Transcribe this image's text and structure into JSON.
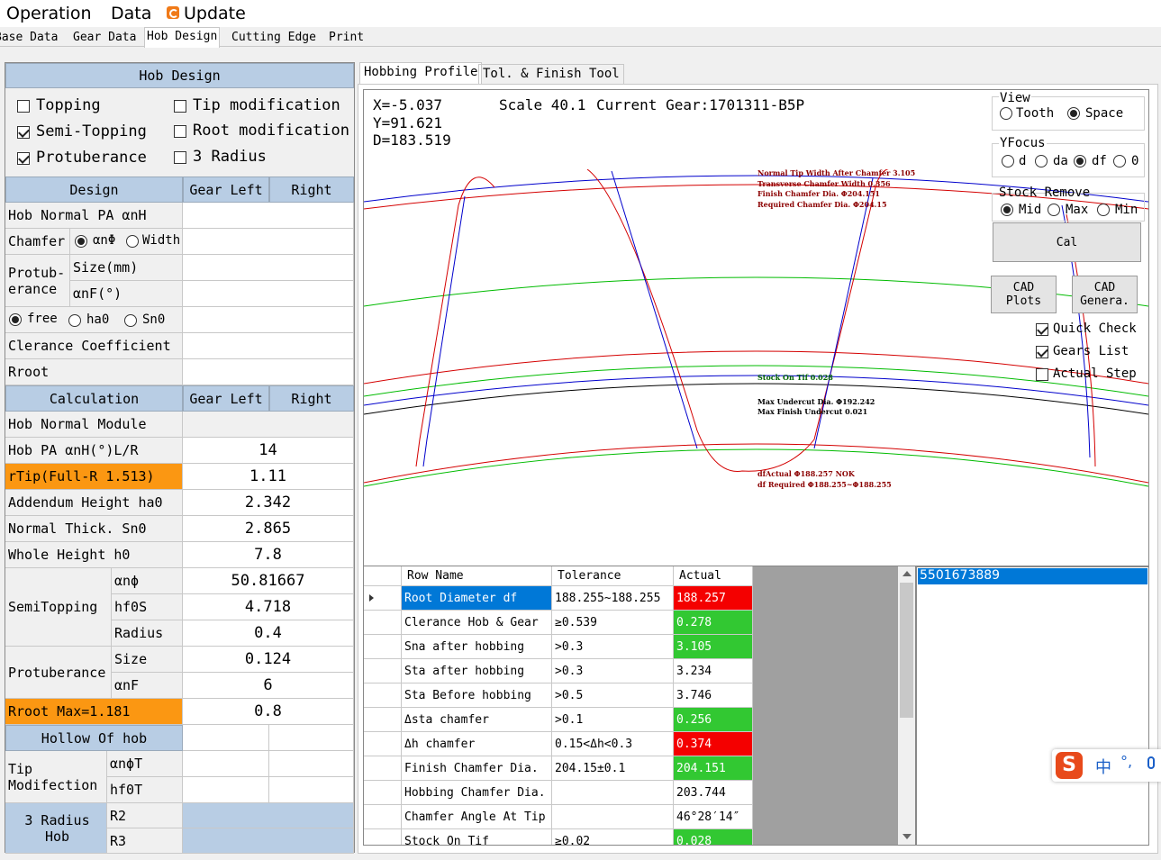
{
  "menu": {
    "operation": "Operation",
    "data": "Data",
    "update": "Update"
  },
  "top_tabs": [
    "Base Data",
    "Gear Data",
    "Hob Design",
    "Cutting Edge",
    "Print"
  ],
  "left": {
    "title": "Hob Design",
    "checks": {
      "topping": "Topping",
      "tip_mod": "Tip modification",
      "semi_topping": "Semi-Topping",
      "root_mod": "Root modification",
      "protuberance": "Protuberance",
      "three_radius": "3 Radius"
    },
    "design_header": {
      "col1": "Design",
      "col2": "Gear Left",
      "col3": "Right"
    },
    "hob_normal_pa": "Hob Normal PA αnH",
    "chamfer": "Chamfer",
    "chamfer_opt1": "αnΦ",
    "chamfer_opt2": "Width",
    "protub_label": "Protub-\nerance",
    "protub_size": "Size(mm)",
    "protub_anf": "αnF(°)",
    "opt_free": "free",
    "opt_ha0": "ha0",
    "opt_sn0": "Sn0",
    "clearance": "Clerance Coefficient",
    "rroot": "Rroot",
    "calc_header": {
      "col1": "Calculation",
      "col2": "Gear Left",
      "col3": "Right"
    },
    "rows": {
      "module_label": "Hob Normal Module",
      "module_val": "",
      "pa_label": "Hob PA αnH(°)L/R",
      "pa_val": "14",
      "rtip_label": "rTip(Full-R 1.513)",
      "rtip_val": "1.11",
      "addendum_label": "Addendum Height ha0",
      "addendum_val": "2.342",
      "thick_label": "Normal Thick. Sn0",
      "thick_val": "2.865",
      "whole_label": "Whole Height h0",
      "whole_val": "7.8",
      "semi_label": "SemiTopping",
      "semi_a_label": "αnϕ",
      "semi_a_val": "50.81667",
      "semi_h_label": "hf0S",
      "semi_h_val": "4.718",
      "semi_r_label": "Radius",
      "semi_r_val": "0.4",
      "prot_label": "Protuberance",
      "prot_s_label": "Size",
      "prot_s_val": "0.124",
      "prot_a_label": "αnF",
      "prot_a_val": "6",
      "rroot_label": "Rroot Max=1.181",
      "rroot_val": "0.8",
      "hollow_label": "Hollow Of hob",
      "tipmod_label": "Tip\nModifection",
      "tipmod_a_label": "αnϕT",
      "tipmod_h_label": "hf0T",
      "r3_label": "3 Radius\nHob",
      "r2": "R2",
      "r3": "R3"
    }
  },
  "right_tabs": [
    "Hobbing Profile",
    "Tol. & Finish Tool"
  ],
  "plot": {
    "x": "X=-5.037",
    "y": "Y=91.621",
    "d": "D=183.519",
    "scale": "Scale 40.1",
    "gear": "Current Gear:1701311-B5P",
    "view_label": "View",
    "view_tooth": "Tooth",
    "view_space": "Space",
    "yfocus_label": "YFocus",
    "yf_d": "d",
    "yf_da": "da",
    "yf_df": "df",
    "yf_0": "0",
    "stock_label": "Stock Remove",
    "st_mid": "Mid",
    "st_max": "Max",
    "st_min": "Min",
    "cal": "Cal",
    "cad_plots": "CAD\nPlots",
    "cad_genera": "CAD\nGenera.",
    "quick_check": "Quick Check",
    "gears_list": "Gears List",
    "actual_step": "Actual Step",
    "annotations": {
      "a1": "Normal Tip Width After Chamfer 3.105",
      "a2": "Transverse Chamfer Width 0.356",
      "a3": "Finish Chamfer Dia. Φ204.151",
      "a4": "Required Chamfer Dia. Φ204.15",
      "a5": "Stock On Tif 0.028",
      "a6": "Max Undercut Dia. Φ192.242",
      "a7": "Max Finish Undercut 0.021",
      "a8": "dfActual Φ188.257 NOK",
      "a9": "df Required Φ188.255~Φ188.255"
    },
    "colors": {
      "red": "#d40000",
      "blue": "#0000cc",
      "green": "#00bb00",
      "black": "#000000"
    }
  },
  "grid": {
    "headers": [
      "Row Name",
      "Tolerance",
      "Actual"
    ],
    "rows": [
      {
        "name": "Root Diameter df",
        "tol": "188.255~188.255",
        "act": "188.257",
        "state": "red"
      },
      {
        "name": "Clerance Hob & Gear",
        "tol": "≥0.539",
        "act": "0.278",
        "state": "green"
      },
      {
        "name": "Sna after hobbing",
        "tol": ">0.3",
        "act": "3.105",
        "state": "green"
      },
      {
        "name": "Sta after hobbing",
        "tol": ">0.3",
        "act": "3.234",
        "state": "white"
      },
      {
        "name": "Sta Before hobbing",
        "tol": ">0.5",
        "act": "3.746",
        "state": "white"
      },
      {
        "name": "Δsta chamfer",
        "tol": ">0.1",
        "act": "0.256",
        "state": "green"
      },
      {
        "name": "Δh chamfer",
        "tol": "0.15<Δh<0.3",
        "act": "0.374",
        "state": "red"
      },
      {
        "name": "Finish Chamfer Dia.",
        "tol": "204.15±0.1",
        "act": "204.151",
        "state": "green"
      },
      {
        "name": "Hobbing Chamfer Dia.",
        "tol": "",
        "act": "203.744",
        "state": "white"
      },
      {
        "name": "Chamfer Angle At Tip",
        "tol": "",
        "act": "46°28′14″",
        "state": "white"
      },
      {
        "name": "Stock On Tif",
        "tol": "≥0.02",
        "act": "0.028",
        "state": "green"
      }
    ]
  },
  "list": {
    "selected": "5501673889"
  },
  "ime": {
    "char": "中",
    "extra": "°,"
  }
}
